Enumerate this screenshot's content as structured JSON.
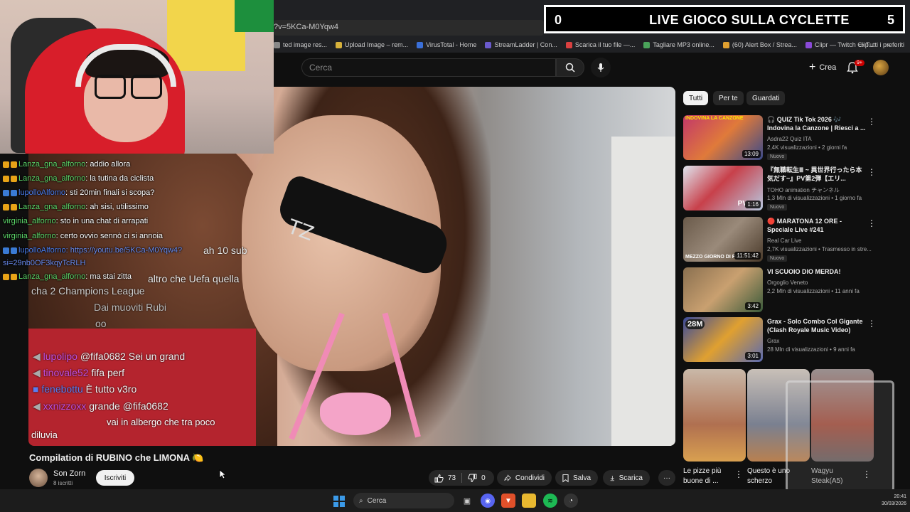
{
  "browser": {
    "url_fragment": "?v=5KCa-M0Yqw4",
    "bookmarks": [
      {
        "label": "ted image res...",
        "color": "#888888"
      },
      {
        "label": "Upload Image – rem...",
        "color": "#d6b13b"
      },
      {
        "label": "VirusTotal - Home",
        "color": "#3a6fd8"
      },
      {
        "label": "StreamLadder | Con...",
        "color": "#6a5acd"
      },
      {
        "label": "Scarica il tuo file —...",
        "color": "#d94040"
      },
      {
        "label": "Tagliare MP3 online...",
        "color": "#4aa35a"
      },
      {
        "label": "(60) Alert Box / Strea...",
        "color": "#e0a030"
      },
      {
        "label": "Clipr — Twitch Clip...",
        "color": "#8a4ad8"
      }
    ],
    "bookmarks_more": "»",
    "all_favorites": "Tutti i preferiti"
  },
  "youtube": {
    "search_placeholder": "Cerca",
    "create_label": "Crea",
    "notif_count": "9+"
  },
  "scoreboard": {
    "left_score": "0",
    "title": "LIVE GIOCO SULLA CYCLETTE",
    "right_score": "5"
  },
  "chat": [
    {
      "user": "Lanza_gna_alforno",
      "message": ": addio allora",
      "color": "green"
    },
    {
      "user": "Lanza_gna_alforno",
      "message": ": la tutina da ciclista",
      "color": "green"
    },
    {
      "user": "lupolloAlfomo",
      "message": ": sti 20min finali si scopa?",
      "color": "blue"
    },
    {
      "user": "Lanza_gna_alforno",
      "message": ": ah sisi, utilissimo",
      "color": "green"
    },
    {
      "user": "virginia_alforno",
      "message": ": sto in una chat di arrapati",
      "color": "green"
    },
    {
      "user": "virginia_alforno",
      "message": ": certo ovvio sennò ci si annoia",
      "color": "green"
    },
    {
      "user": "lupolloAlforno",
      "message": ": https://youtu.be/5KCa-M0Yqw4?",
      "color": "blue"
    },
    {
      "user": "",
      "message": "si=29nb0OF3kqyTcRLH",
      "color": "none"
    },
    {
      "user": "Lanza_gna_alforno",
      "message": ": ma stai zitta",
      "color": "green"
    }
  ],
  "video_chat_overlay": [
    {
      "text": "altro che Uefa quella",
      "color": "#e8e8e8"
    },
    {
      "text": "cha 2 Champions League",
      "color": "#cfcfcf"
    },
    {
      "text": "Dai muoviti Rubi",
      "color": "#b9b9b9"
    },
    {
      "text": "oo",
      "color": "#b9b9b9"
    },
    {
      "user": "lupolipo",
      "text": "@fifa0682 Sei un grand",
      "color": "#c04ee0"
    },
    {
      "user": "tinovale52",
      "text": "fifa perf",
      "color": "#c04ee0"
    },
    {
      "user": "fenebottu",
      "text": "È tutto v3ro",
      "color": "#5b7cf0"
    },
    {
      "user": "xxnizzoxx",
      "text": "grande @fifa0682",
      "color": "#c04ee0"
    },
    {
      "text": "vai in albergo che tra poco",
      "color": "#ffffff"
    },
    {
      "text": "diluvia",
      "color": "#ffffff"
    },
    {
      "text": "ah 10 sub",
      "color": "#e8e8e8"
    }
  ],
  "video": {
    "title": "Compilation di RUBINO che LIMONA",
    "title_emoji": "🍋",
    "channel": "Son Zorn",
    "subscribers": "8 iscritti",
    "subscribe_label": "Iscriviti",
    "likes": "73",
    "dislikes": "0",
    "share_label": "Condividi",
    "save_label": "Salva",
    "download_label": "Scarica",
    "more": "···",
    "glasses_text": "TZ"
  },
  "chips": [
    "Tutti",
    "Per te",
    "Guardati"
  ],
  "recommendations": [
    {
      "title": "🎧 QUIZ Tik Tok 2026 🎶 Indovina la Canzone | Riesci a ...",
      "channel": "Asdra22 Quiz ITA",
      "meta": "2,4K visualizzazioni • 2 giorni fa",
      "badge": "Nuovo",
      "duration": "13:09",
      "thumb_label": "INDOVINA LA CANZONE",
      "thumb_color": "#c2376a"
    },
    {
      "title": "『無職転生Ⅲ ~ 異世界行ったら本気だす~』PV第2弾【エリ...",
      "channel": "TOHO animation チャンネル",
      "meta": "1,3 Mln di visualizzazioni • 1 giorno fa",
      "badge": "Nuovo",
      "duration": "1:16",
      "thumb_label": "PV",
      "thumb_color": "#b8c8e0"
    },
    {
      "title": "🔴 MARATONA 12 ORE - Speciale Live #241",
      "channel": "Real Car Live",
      "meta": "2,7K visualizzazioni • Trasmesso in stre...",
      "badge": "Nuovo",
      "duration": "11:51:42",
      "thumb_label": "MEZZO GIORNO DI FU...",
      "thumb_color": "#6a5a4a"
    },
    {
      "title": "VI SCUOIO DIO MERDA!",
      "channel": "Orgoglio Veneto",
      "meta": "2,2 Mln di visualizzazioni • 11 anni fa",
      "badge": "",
      "duration": "3:42",
      "thumb_label": "",
      "thumb_color": "#8a7050"
    },
    {
      "title": "Grax - Solo Combo Col Gigante (Clash Royale Music Video)",
      "channel": "Grax",
      "meta": "28 Mln di visualizzazioni • 9 anni fa",
      "badge": "",
      "duration": "3:01",
      "thumb_label": "28M",
      "thumb_color": "#5a6ab0"
    }
  ],
  "shorts": [
    {
      "title": "Le pizze più buone di ...",
      "color": "#b07050"
    },
    {
      "title": "Questo è uno scherzo",
      "color": "#7a8090"
    },
    {
      "title": "Wagyu Steak(A5)",
      "color": "#a05040"
    }
  ],
  "taskbar": {
    "search_label": "Cerca",
    "time": "20:41",
    "date": "30/03/2026"
  }
}
